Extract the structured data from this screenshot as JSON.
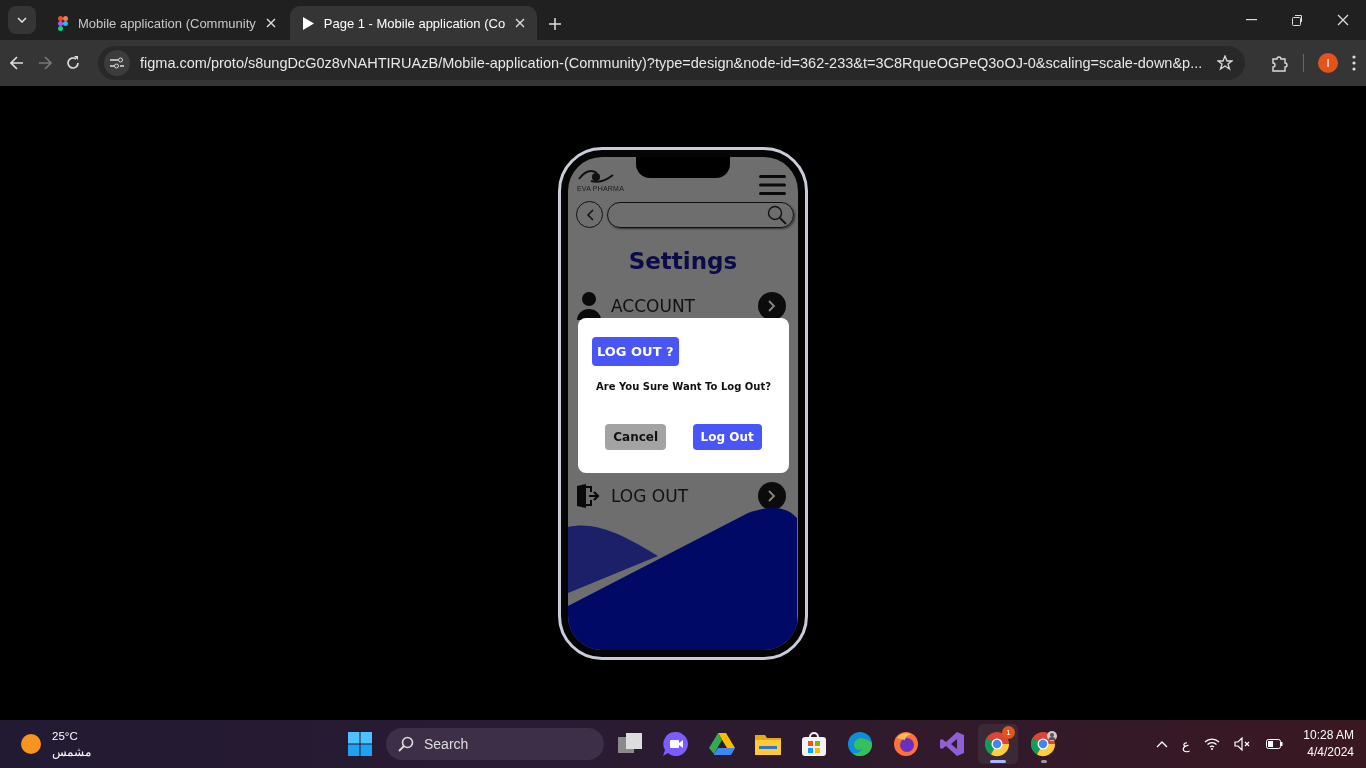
{
  "browser": {
    "tabs": [
      {
        "title": "Mobile application (Community",
        "kind": "figma",
        "selected": false
      },
      {
        "title": "Page 1 - Mobile application (Co",
        "kind": "play",
        "selected": true
      }
    ],
    "url": "figma.com/proto/s8ungDcG0z8vNAHTIRUAzB/Mobile-application-(Community)?type=design&node-id=362-233&t=3C8RqueOGPeQ3oOJ-0&scaling=scale-down&p...",
    "profile_initial": "I"
  },
  "app": {
    "brand": "EVA PHARMA",
    "title": "Settings",
    "items": [
      {
        "label": "ACCOUNT",
        "kind": "account"
      },
      {
        "label": "LOG OUT",
        "kind": "logout"
      }
    ],
    "dialog": {
      "title": "LOG OUT ?",
      "message": "Are You Sure Want To Log Out?",
      "buttons": [
        {
          "label": "Cancel",
          "kind": "secondary"
        },
        {
          "label": "Log Out",
          "kind": "primary"
        }
      ]
    }
  },
  "taskbar": {
    "weather": {
      "temp": "25°C",
      "condition": "مشمس"
    },
    "search": {
      "placeholder": "Search"
    },
    "apps": [
      {
        "kind": "taskview",
        "selected": false
      },
      {
        "kind": "meet",
        "selected": false
      },
      {
        "kind": "drive",
        "selected": false
      },
      {
        "kind": "files",
        "selected": false
      },
      {
        "kind": "store",
        "selected": false
      },
      {
        "kind": "edge",
        "selected": false
      },
      {
        "kind": "firefox",
        "selected": false
      },
      {
        "kind": "vs",
        "selected": false
      },
      {
        "kind": "chrome",
        "selected": true,
        "badge": "1"
      },
      {
        "kind": "chrome-profile",
        "selected": false
      }
    ],
    "tray": {
      "language": "ع",
      "time": "10:28 AM",
      "date": "4/4/2024"
    }
  }
}
